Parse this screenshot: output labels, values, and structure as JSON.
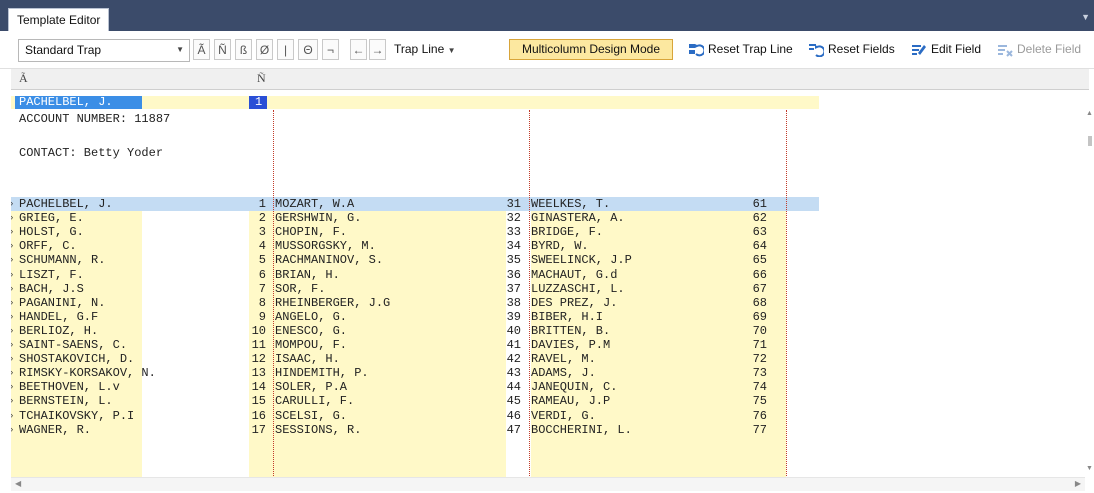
{
  "window": {
    "tab_title": "Template Editor"
  },
  "toolbar": {
    "trap_combo_value": "Standard Trap",
    "symbol_buttons": [
      "Ã",
      "Ñ",
      "ß",
      "Ø",
      "|",
      "Θ",
      "¬"
    ],
    "nav_left": "←",
    "nav_right": "→",
    "trap_line_label": "Trap Line",
    "multicolumn_label": "Multicolumn Design Mode",
    "reset_trap_line": "Reset Trap Line",
    "reset_fields": "Reset Fields",
    "edit_field": "Edit Field",
    "delete_field": "Delete Field"
  },
  "header": {
    "col1": "Ã",
    "col2": "Ñ"
  },
  "trap": {
    "name": "PACHELBEL, J.",
    "number": "1",
    "account_line": "ACCOUNT NUMBER: 11887",
    "contact_line": "CONTACT: Betty Yoder"
  },
  "rows": [
    {
      "n1": "PACHELBEL, J.",
      "v1": "1",
      "n2": "MOZART, W.A",
      "v2": "31",
      "n3": "WEELKES, T.",
      "v3": "61"
    },
    {
      "n1": "GRIEG, E.",
      "v1": "2",
      "n2": "GERSHWIN, G.",
      "v2": "32",
      "n3": "GINASTERA, A.",
      "v3": "62"
    },
    {
      "n1": "HOLST, G.",
      "v1": "3",
      "n2": "CHOPIN, F.",
      "v2": "33",
      "n3": "BRIDGE, F.",
      "v3": "63"
    },
    {
      "n1": "ORFF, C.",
      "v1": "4",
      "n2": "MUSSORGSKY, M.",
      "v2": "34",
      "n3": "BYRD, W.",
      "v3": "64"
    },
    {
      "n1": "SCHUMANN, R.",
      "v1": "5",
      "n2": "RACHMANINOV, S.",
      "v2": "35",
      "n3": "SWEELINCK, J.P",
      "v3": "65"
    },
    {
      "n1": "LISZT, F.",
      "v1": "6",
      "n2": "BRIAN, H.",
      "v2": "36",
      "n3": "MACHAUT, G.d",
      "v3": "66"
    },
    {
      "n1": "BACH, J.S",
      "v1": "7",
      "n2": "SOR, F.",
      "v2": "37",
      "n3": "LUZZASCHI, L.",
      "v3": "67"
    },
    {
      "n1": "PAGANINI, N.",
      "v1": "8",
      "n2": "RHEINBERGER, J.G",
      "v2": "38",
      "n3": "DES PREZ, J.",
      "v3": "68"
    },
    {
      "n1": "HANDEL, G.F",
      "v1": "9",
      "n2": "ANGELO, G.",
      "v2": "39",
      "n3": "BIBER, H.I",
      "v3": "69"
    },
    {
      "n1": "BERLIOZ, H.",
      "v1": "10",
      "n2": "ENESCO, G.",
      "v2": "40",
      "n3": "BRITTEN, B.",
      "v3": "70"
    },
    {
      "n1": "SAINT-SAENS, C.",
      "v1": "11",
      "n2": "MOMPOU, F.",
      "v2": "41",
      "n3": "DAVIES, P.M",
      "v3": "71"
    },
    {
      "n1": "SHOSTAKOVICH, D.",
      "v1": "12",
      "n2": "ISAAC, H.",
      "v2": "42",
      "n3": "RAVEL, M.",
      "v3": "72"
    },
    {
      "n1": "RIMSKY-KORSAKOV, N.",
      "v1": "13",
      "n2": "HINDEMITH, P.",
      "v2": "43",
      "n3": "ADAMS, J.",
      "v3": "73"
    },
    {
      "n1": "BEETHOVEN, L.v",
      "v1": "14",
      "n2": "SOLER, P.A",
      "v2": "44",
      "n3": "JANEQUIN, C.",
      "v3": "74"
    },
    {
      "n1": "BERNSTEIN, L.",
      "v1": "15",
      "n2": "CARULLI, F.",
      "v2": "45",
      "n3": "RAMEAU, J.P",
      "v3": "75"
    },
    {
      "n1": "TCHAIKOVSKY, P.I",
      "v1": "16",
      "n2": "SCELSI, G.",
      "v2": "46",
      "n3": "VERDI, G.",
      "v3": "76"
    },
    {
      "n1": "WAGNER, R.",
      "v1": "17",
      "n2": "SESSIONS, R.",
      "v2": "47",
      "n3": "BOCCHERINI, L.",
      "v3": "77"
    }
  ],
  "colors": {
    "title_bar": "#3b4b6a",
    "band_yellow": "#fff9c8",
    "selection_blue": "#3b8ee6",
    "row_highlight": "#c4dcf3",
    "column_divider": "#c23b2a",
    "mode_highlight": "#fce8a0"
  },
  "icons": {
    "reset_trap_line": "reset-trap-line-icon",
    "reset_fields": "reset-fields-icon",
    "edit_field": "edit-field-icon",
    "delete_field": "delete-field-icon"
  }
}
